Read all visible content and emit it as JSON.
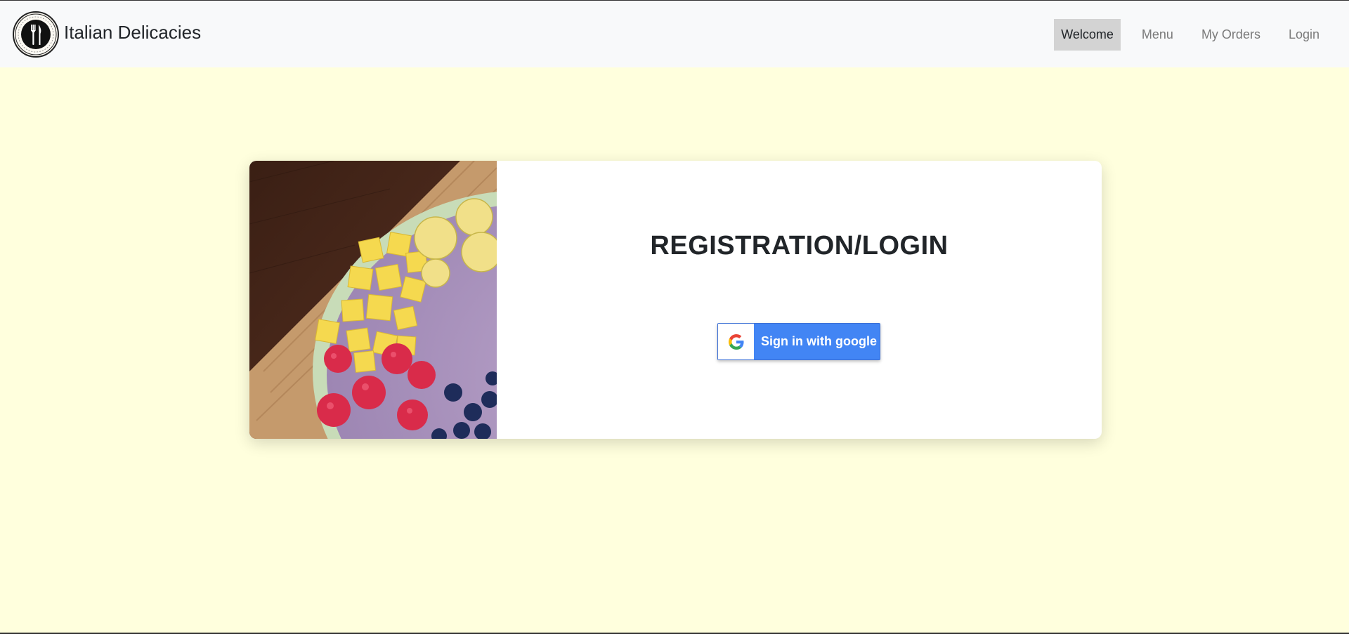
{
  "brand": {
    "name": "Italian Delicacies",
    "logo_icon": "fork-knife-icon"
  },
  "nav": {
    "items": [
      {
        "label": "Welcome",
        "active": true
      },
      {
        "label": "Menu",
        "active": false
      },
      {
        "label": "My Orders",
        "active": false
      },
      {
        "label": "Login",
        "active": false
      }
    ]
  },
  "card": {
    "title": "REGISTRATION/LOGIN",
    "image": "fruit-smoothie-bowl",
    "google_button": {
      "label": "Sign in with google",
      "icon": "google-icon"
    }
  },
  "colors": {
    "page_background": "#ffffdd",
    "navbar_background": "#f8f9fa",
    "google_blue": "#4285f4",
    "active_nav_background": "#d3d3d3"
  }
}
